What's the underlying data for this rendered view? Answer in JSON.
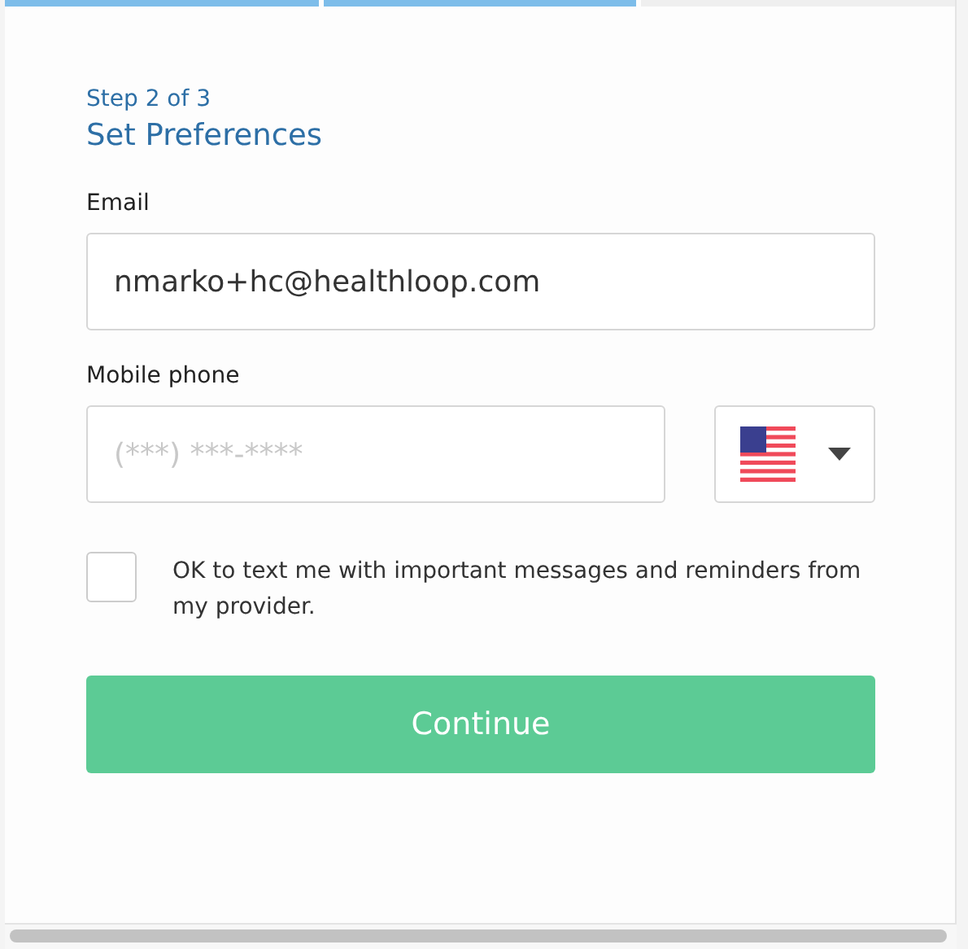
{
  "progress": [
    {
      "done": true
    },
    {
      "done": true
    },
    {
      "done": false
    }
  ],
  "step": "Step 2 of 3",
  "title": "Set Preferences",
  "email": {
    "label": "Email",
    "value": "nmarko+hc@healthloop.com"
  },
  "phone": {
    "label": "Mobile phone",
    "placeholder": "(***) ***-****"
  },
  "consent": {
    "label": "OK to text me with important messages and reminders from my provider.",
    "checked": false
  },
  "button": "Continue"
}
